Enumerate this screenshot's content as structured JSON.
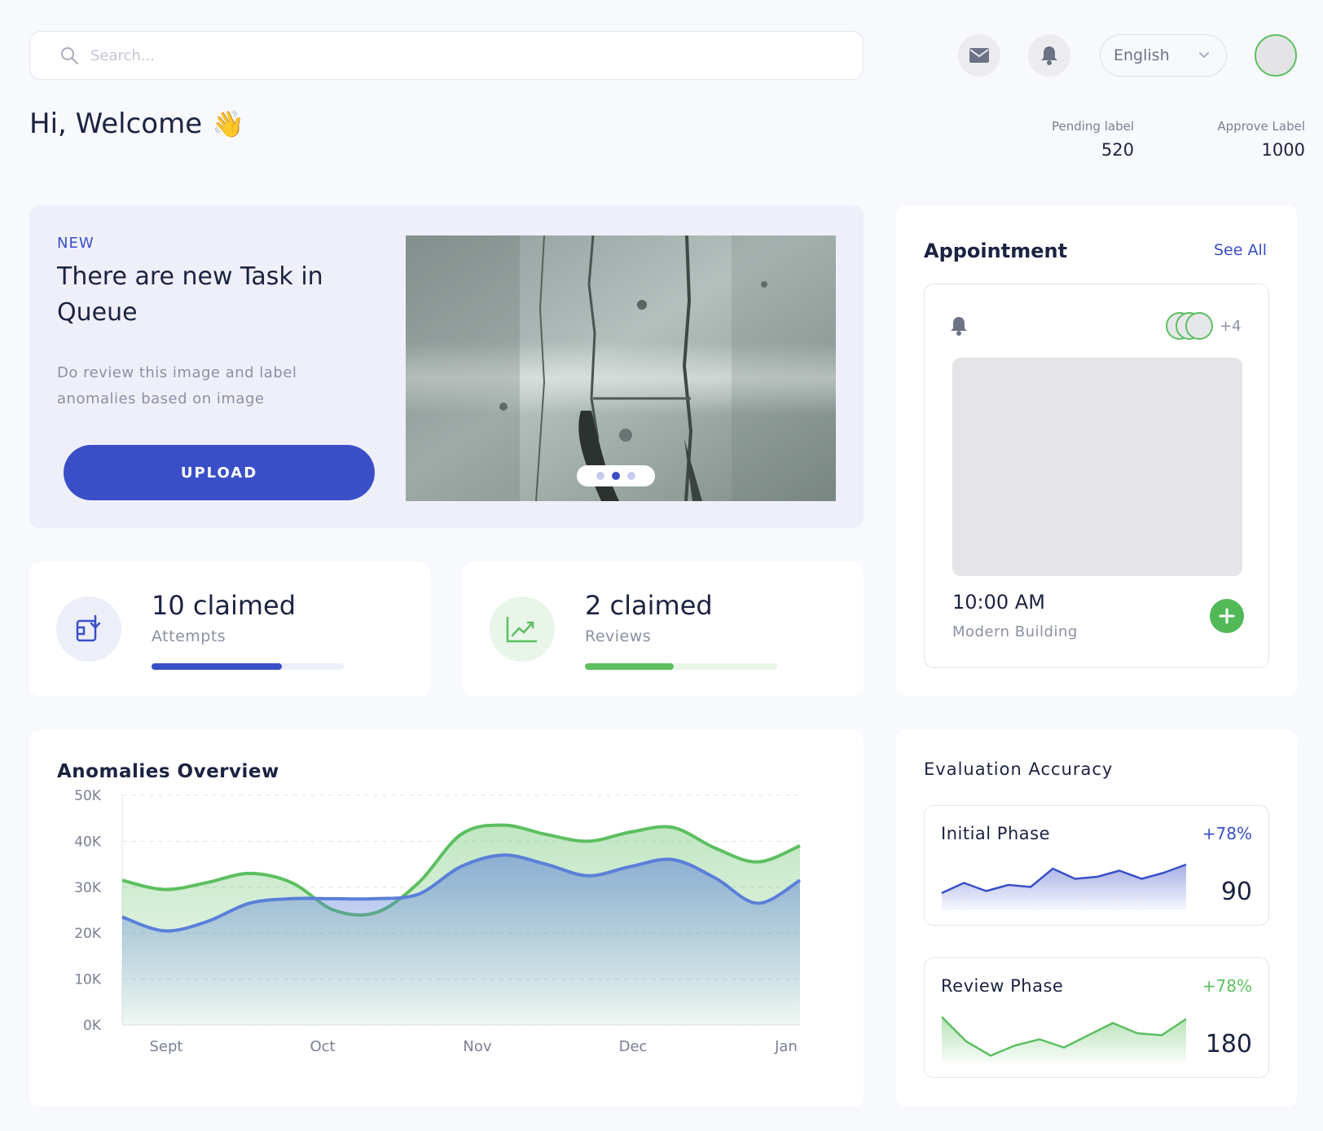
{
  "header": {
    "search_placeholder": "Search...",
    "language": "English",
    "icons": [
      "mail-icon",
      "bell-icon",
      "search-icon",
      "chevron-down-icon"
    ]
  },
  "welcome": {
    "text": "Hi, Welcome",
    "emoji": "👋"
  },
  "stats": {
    "pending_label": "Pending label",
    "pending_value": "520",
    "approve_label": "Approve Label",
    "approve_value": "1000"
  },
  "promo": {
    "tag": "NEW",
    "title": "There are new Task in Queue",
    "description": "Do review this image and label anomalies based on image",
    "upload_label": "UPLOAD",
    "carousel_total": 3,
    "carousel_active_index": 1
  },
  "claims": [
    {
      "count": "10 claimed",
      "label": "Attempts",
      "progress": 0.68,
      "color": "#3a4fc7",
      "track": "#eceef8",
      "icon": "download-file-icon"
    },
    {
      "count": "2 claimed",
      "label": "Reviews",
      "progress": 0.46,
      "color": "#5cbf60",
      "track": "#e8f5e8",
      "icon": "trend-chart-icon"
    }
  ],
  "appointment": {
    "title": "Appointment",
    "see_all": "See All",
    "extra_attendees": "+4",
    "time": "10:00 AM",
    "location": "Modern Building"
  },
  "chart_data": {
    "type": "area",
    "title": "Anomalies Overview",
    "categories": [
      "Sept",
      "Oct",
      "Nov",
      "Dec",
      "Jan"
    ],
    "y_ticks": [
      "50K",
      "40K",
      "30K",
      "20K",
      "10K",
      "0K"
    ],
    "ylim": [
      0,
      50000
    ],
    "x": [
      0,
      0.5,
      1,
      1.5,
      2,
      2.5,
      3,
      3.5,
      4,
      4.5,
      5,
      5.5,
      6,
      6.5,
      7,
      7.5,
      8
    ],
    "series": [
      {
        "color": "#5cbf60",
        "values": [
          31500,
          29500,
          31000,
          33000,
          31000,
          25000,
          24500,
          31000,
          41500,
          43500,
          41500,
          40000,
          42000,
          43000,
          38500,
          35500,
          39000
        ]
      },
      {
        "color": "#5b7fd9",
        "values": [
          23500,
          20500,
          22500,
          26500,
          27500,
          27500,
          27500,
          28500,
          34500,
          37000,
          35000,
          32500,
          34500,
          36000,
          32000,
          26500,
          31500
        ]
      }
    ],
    "grid": true
  },
  "evaluation": {
    "title": "Evaluation  Accuracy",
    "phases": [
      {
        "name": "Initial Phase",
        "change": "+78%",
        "score": "90",
        "color": "#3a4fc7",
        "spark": [
          0.3,
          0.55,
          0.35,
          0.5,
          0.45,
          0.9,
          0.65,
          0.7,
          0.85,
          0.65,
          0.8,
          1.0
        ]
      },
      {
        "name": "Review Phase",
        "change": "+78%",
        "score": "180",
        "color": "#5cbf60",
        "spark": [
          1.0,
          0.4,
          0.05,
          0.3,
          0.45,
          0.25,
          0.55,
          0.85,
          0.6,
          0.55,
          0.95
        ]
      }
    ]
  }
}
